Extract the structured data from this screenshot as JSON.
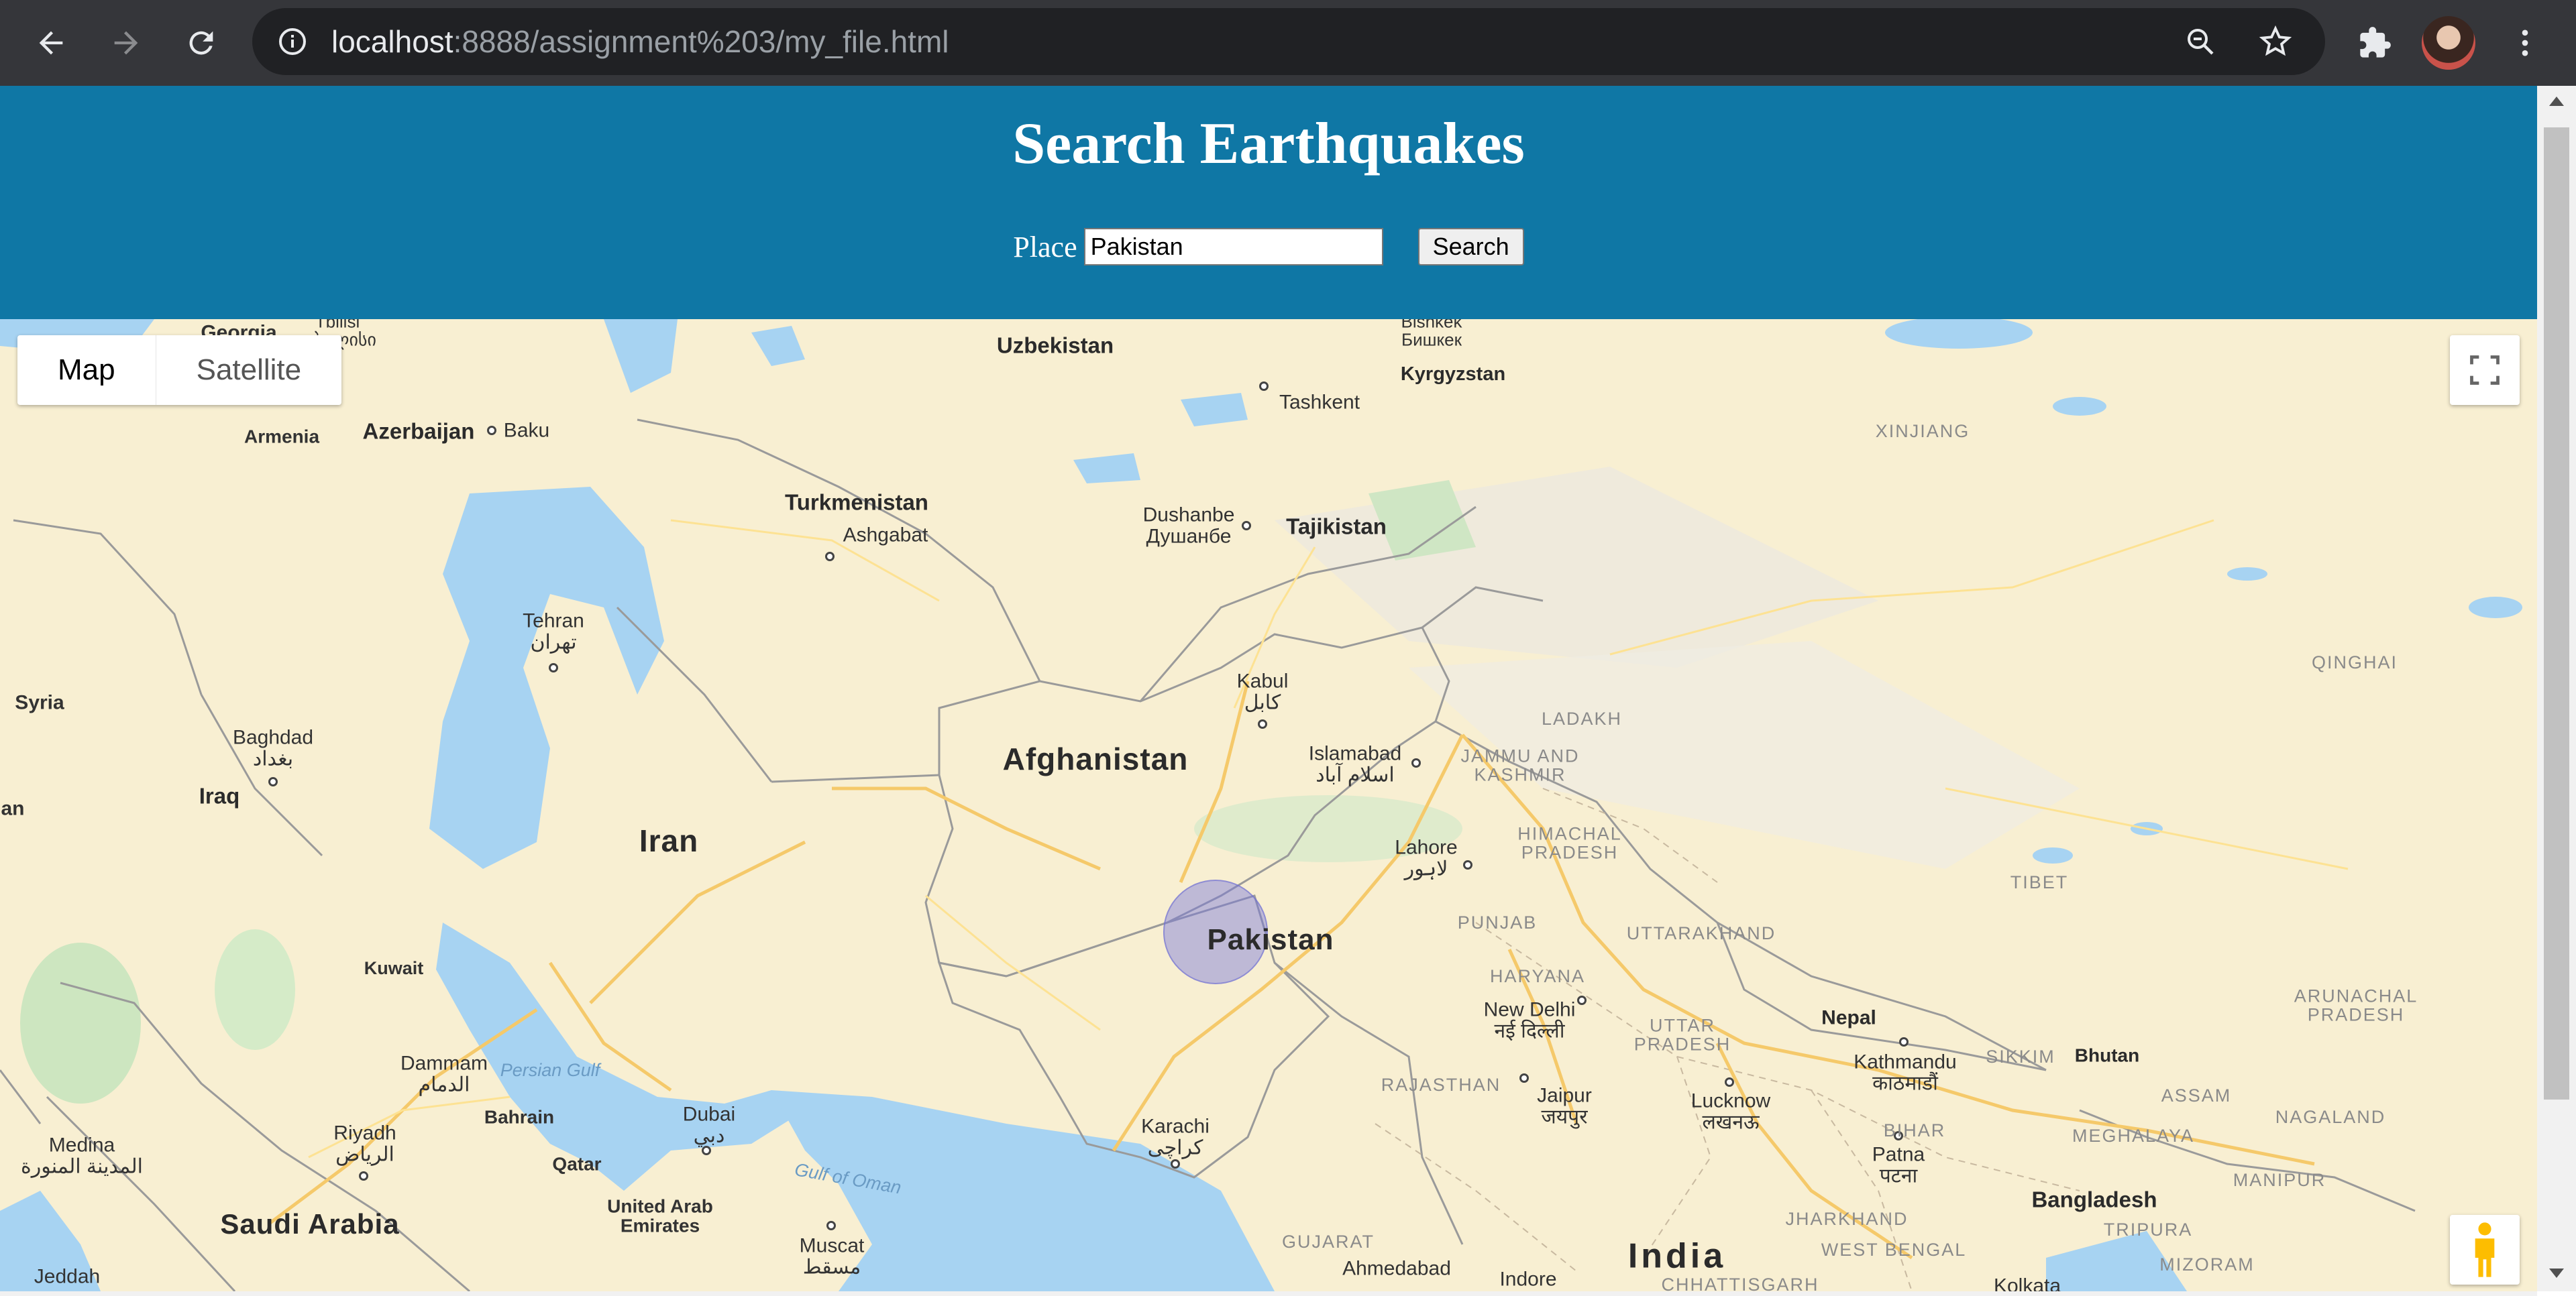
{
  "browser": {
    "url_host": "localhost",
    "url_rest": ":8888/assignment%203/my_file.html"
  },
  "header": {
    "title": "Search Earthquakes",
    "place_label": "Place",
    "place_value": "Pakistan",
    "search_label": "Search"
  },
  "map": {
    "type_map": "Map",
    "type_satellite": "Satellite",
    "marker_label": "Pakistan",
    "labels": {
      "uzbekistan": "Uzbekistan",
      "bishkek": "Bishkek\nБишкек",
      "kyrgyzstan": "Kyrgyzstan",
      "tashkent": "Tashkent",
      "xinjiang": "XINJIANG",
      "georgia": "Georgia",
      "tbilisi": "Tbilisi\nთბილისი",
      "armenia": "Armenia",
      "azerbaijan": "Azerbaijan",
      "baku": "Baku",
      "turkmenistan": "Turkmenistan",
      "ashgabat": "Ashgabat",
      "dushanbe": "Dushanbe\nДушанбе",
      "tajikistan": "Tajikistan",
      "tehran": "Tehran\nتهران",
      "qinghai": "QINGHAI",
      "syria": "Syria",
      "kabul": "Kabul\nکابل",
      "ladakh": "LADAKH",
      "baghdad": "Baghdad\nبغداد",
      "afghanistan": "Afghanistan",
      "islamabad": "Islamabad\nاسلام آباد",
      "jammu": "JAMMU AND\nKASHMIR",
      "iraq": "Iraq",
      "iran": "Iran",
      "himachal": "HIMACHAL\nPRADESH",
      "lahore": "Lahore\nلاہور",
      "tibet": "TIBET",
      "punjab": "PUNJAB",
      "uttarakhand": "UTTARAKHAND",
      "kuwait": "Kuwait",
      "haryana": "HARYANA",
      "new_delhi": "New Delhi\nनई दिल्ली",
      "nepal": "Nepal",
      "arunachal": "ARUNACHAL\nPRADESH",
      "uttar_pradesh": "UTTAR\nPRADESH",
      "kathmandu": "Kathmandu\nकाठमाडौं",
      "sikkim": "SIKKIM",
      "bhutan": "Bhutan",
      "dammam": "Dammam\nالدمام",
      "persian_gulf": "Persian Gulf",
      "rajasthan": "RAJASTHAN",
      "jaipur": "Jaipur\nजयपुर",
      "lucknow": "Lucknow\nलखनऊ",
      "assam": "ASSAM",
      "bahrain": "Bahrain",
      "dubai": "Dubai\nدبي",
      "nagaland": "NAGALAND",
      "medina": "Medina\nالمدينة المنورة",
      "riyadh": "Riyadh\nالرياض",
      "karachi": "Karachi\nکراچی",
      "bihar": "BIHAR",
      "meghalaya": "MEGHALAYA",
      "qatar": "Qatar",
      "patna": "Patna\nपटना",
      "gulf_of_oman": "Gulf of Oman",
      "manipur": "MANIPUR",
      "united_arab_emirates": "United Arab\nEmirates",
      "saudi_arabia": "Saudi Arabia",
      "muscat": "Muscat\nمسقط",
      "jharkhand": "JHARKHAND",
      "bangladesh": "Bangladesh",
      "tripura": "TRIPURA",
      "gujarat": "GUJARAT",
      "west_bengal": "WEST BENGAL",
      "india": "India",
      "mizoram": "MIZORAM",
      "jeddah": "Jeddah",
      "ahmedabad": "Ahmedabad",
      "indore": "Indore",
      "chhattisgarh": "CHHATTISGARH",
      "kolkata": "Kolkata",
      "an": "an"
    }
  },
  "colors": {
    "header_bg": "#0f77a5",
    "land": "#f8efd2",
    "water": "#a7d3f2",
    "marker_fill": "#7878dc"
  }
}
